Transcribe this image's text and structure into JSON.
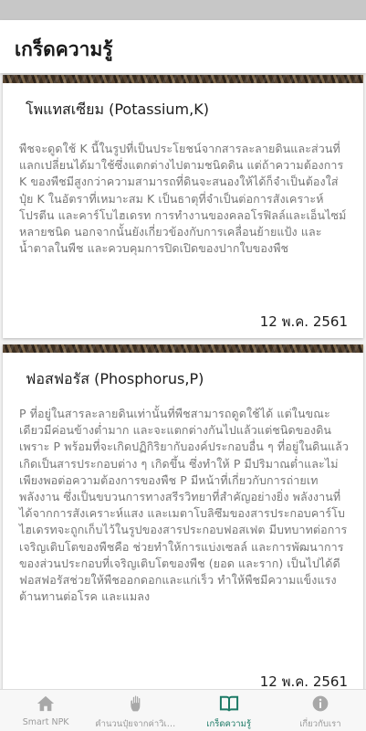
{
  "app_bar": {
    "title": "เกร็ดความรู้"
  },
  "cards": [
    {
      "title": "โพแทสเซียม (Potassium,K)",
      "body": "พืชจะดูดใช้ K นี้ในรูปที่เป็นประโยชน์จากสารละลายดินและส่วนที่แลกเปลี่ยนได้มาใช้ซึ่งแตกต่างไปตามชนิดดิน แต่ถ้าความต้องการ K ของพืชมีสูงกว่าความสามารถที่ดินจะสนองให้ได้ก็จำเป็นต้องใส่ปุ๋ย K ในอัตราที่เหมาะสม  K เป็นธาตุที่จำเป็นต่อการสังเคราะห์ โปรตีน และคาร์โบไฮเดรท การทำงานของคลอโรฟิลล์และเอ็นไซม์หลายชนิด นอกจากนั้นยังเกี่ยวข้องกับการเคลื่อนย้ายแป้ง และน้ำตาลในพืช และควบคุมการปิดเปิดของปากใบของพืช",
      "date": "12 พ.ค. 2561"
    },
    {
      "title": "ฟอสฟอรัส (Phosphorus,P)",
      "body": "P ที่อยู่ในสารละลายดินเท่านั้นที่พืชสามารถดูดใช้ได้ แต่ในขณะเดียวมีค่อนข้างต่ำมาก และจะแตกต่างกันไปแล้วแต่ชนิดของดิน เพราะ P พร้อมที่จะเกิดปฏิกิริยากับองค์ประกอบอื่น ๆ ที่อยู่ในดินแล้วเกิดเป็นสารประกอบต่าง ๆ เกิดขึ้น ซึ่งทำให้ P มีปริมาณต่ำและไม่เพียงพอต่อความต้องการของพืช P มีหน้าที่เกี่ยวกับการถ่ายเทพลังงาน ซึ่งเป็นขบวนการทางสรีรวิทยาที่สำคัญอย่างยิ่ง พลังงานที่ได้จากการสังเคราะห์แสง และเมตาโบลิซึมของสารประกอบคาร์โบไฮเดรทจะถูกเก็บไว้ในรูปของสารประกอบฟอสเฟต มีบทบาทต่อการเจริญเติบโตของพืชคือ ช่วยทำให้การแบ่งเซลล์ และการพัฒนาการของส่วนประกอบที่เจริญเติบโตของพืช (ยอด และราก) เป็นไปได้ดี ฟอสฟอรัสช่วยให้พืชออกดอกและแก่เร็ว ทำให้พืชมีความแข็งแรง ต้านทานต่อโรค และแมลง",
      "date": "12 พ.ค. 2561"
    }
  ],
  "bottom_nav": {
    "active_color": "#1c7a66",
    "inactive_color": "#9a9a9a",
    "items": [
      {
        "label": "Smart NPK",
        "icon": "home-icon"
      },
      {
        "label": "คำนวนปุ๋ยจากค่าวิเคราะห์ดิน",
        "icon": "hand-icon"
      },
      {
        "label": "เกร็ดความรู้",
        "icon": "book-icon"
      },
      {
        "label": "เกี่ยวกับเรา",
        "icon": "info-icon"
      }
    ]
  }
}
